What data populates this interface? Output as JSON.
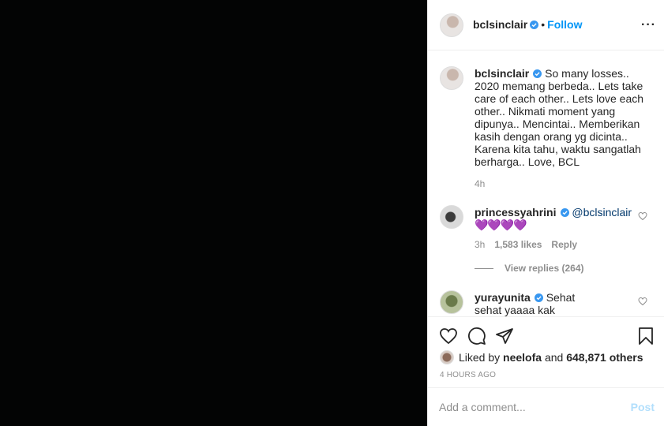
{
  "header": {
    "username": "bclsinclair",
    "separator": "•",
    "follow_label": "Follow",
    "more_label": "···"
  },
  "caption": {
    "username": "bclsinclair",
    "text": "So many losses.. 2020 memang berbeda.. Lets take care of each other.. Lets love each other.. Nikmati moment yang dipunya.. Mencintai.. Memberikan kasih dengan orang yg dicinta.. Karena kita tahu, waktu sangatlah berharga.. Love, BCL",
    "time": "4h"
  },
  "comments": [
    {
      "username": "princessyahrini",
      "mention": "@bclsinclair",
      "text": "💜💜💜💜",
      "time": "3h",
      "likes": "1,583 likes",
      "reply_label": "Reply",
      "view_replies": "View replies (264)"
    },
    {
      "username": "yurayunita",
      "text": "Sehat sehat yaaaa kak Ungeeee 💕"
    }
  ],
  "likes": {
    "prefix": "Liked by",
    "user": "neelofa",
    "and": "and",
    "count": "648,871 others"
  },
  "timestamp": "4 HOURS AGO",
  "add_comment": {
    "placeholder": "Add a comment...",
    "post_label": "Post"
  },
  "colors": {
    "accent": "#0095f6",
    "post_disabled": "#b2dffc",
    "verified": "#3897f0",
    "media_bg": "#030404"
  }
}
